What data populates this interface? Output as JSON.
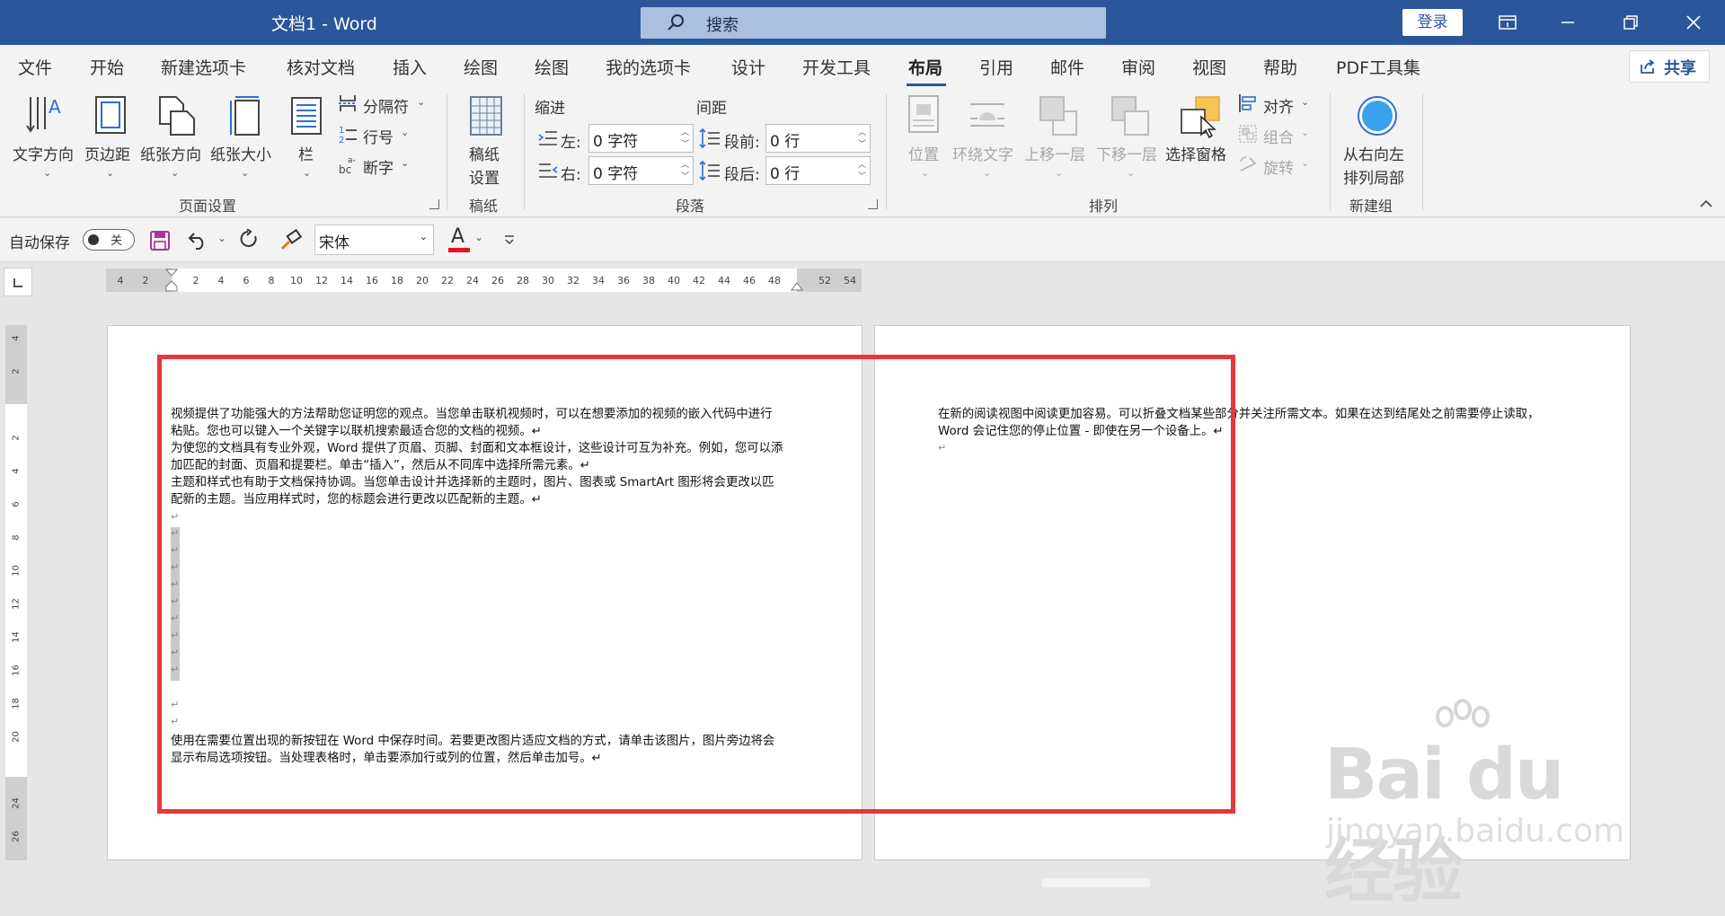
{
  "titlebar": {
    "doc_title": "文档1  -  Word",
    "search_label": "搜索",
    "login_label": "登录"
  },
  "menu": {
    "tabs": [
      "文件",
      "开始",
      "新建选项卡",
      "核对文档",
      "插入",
      "绘图",
      "绘图",
      "我的选项卡",
      "设计",
      "开发工具",
      "布局",
      "引用",
      "邮件",
      "审阅",
      "视图",
      "帮助",
      "PDF工具集"
    ],
    "active_tab": "布局",
    "share_label": "共享"
  },
  "ribbon": {
    "page_setup": {
      "text_direction": "文字方向",
      "margins": "页边距",
      "orientation": "纸张方向",
      "size": "纸张大小",
      "columns": "栏",
      "breaks": "分隔符",
      "line_numbers": "行号",
      "hyphenation": "断字",
      "group_label": "页面设置"
    },
    "manuscript": {
      "setup_line1": "稿纸",
      "setup_line2": "设置",
      "group_label": "稿纸"
    },
    "paragraph": {
      "indent_label": "缩进",
      "spacing_label": "间距",
      "left_label": "左:",
      "right_label": "右:",
      "before_label": "段前:",
      "after_label": "段后:",
      "left_value": "0 字符",
      "right_value": "0 字符",
      "before_value": "0 行",
      "after_value": "0 行",
      "group_label": "段落"
    },
    "arrange": {
      "position": "位置",
      "wrap_text": "环绕文字",
      "bring_forward": "上移一层",
      "send_backward": "下移一层",
      "selection_pane": "选择窗格",
      "align": "对齐",
      "group": "组合",
      "rotate": "旋转",
      "group_label": "排列"
    },
    "new_group": {
      "rtl_line1": "从右向左",
      "rtl_line2": "排列局部",
      "group_label": "新建组"
    }
  },
  "qat": {
    "autosave_label": "自动保存",
    "autosave_state": "关",
    "font_name": "宋体",
    "font_color_letter": "A"
  },
  "ruler": {
    "h_ticks": [
      "4",
      "2",
      "",
      "2",
      "4",
      "6",
      "8",
      "10",
      "12",
      "14",
      "16",
      "18",
      "20",
      "22",
      "24",
      "26",
      "28",
      "30",
      "32",
      "34",
      "36",
      "38",
      "40",
      "42",
      "44",
      "46",
      "48",
      "",
      "52",
      "54"
    ],
    "v_ticks": [
      "4",
      "2",
      "",
      "2",
      "4",
      "6",
      "8",
      "10",
      "12",
      "14",
      "16",
      "18",
      "20",
      "",
      "24",
      "26"
    ]
  },
  "page1": {
    "para1_line1": "视频提供了功能强大的方法帮助您证明您的观点。当您单击联机视频时，可以在想要添加的视频的嵌入代码中进行",
    "para1_line2": "粘贴。您也可以键入一个关键字以联机搜索最适合您的文档的视频。↵",
    "para2_line1": "为使您的文档具有专业外观，Word 提供了页眉、页脚、封面和文本框设计，这些设计可互为补充。例如，您可以添",
    "para2_line2": "加匹配的封面、页眉和提要栏。单击“插入”，然后从不同库中选择所需元素。↵",
    "para3_line1": "主题和样式也有助于文档保持协调。当您单击设计并选择新的主题时，图片、图表或 SmartArt 图形将会更改以匹",
    "para3_line2": "配新的主题。当应用样式时，您的标题会进行更改以匹配新的主题。↵",
    "para_mark": "↵",
    "para4_line1": "使用在需要位置出现的新按钮在 Word 中保存时间。若要更改图片适应文档的方式，请单击该图片，图片旁边将会",
    "para4_line2": "显示布局选项按钮。当处理表格时，单击要添加行或列的位置，然后单击加号。↵"
  },
  "page2": {
    "line1": "在新的阅读视图中阅读更加容易。可以折叠文档某些部分并关注所需文本。如果在达到结尾处之前需要停止读取，",
    "line2": "Word 会记住您的停止位置 - 即使在另一个设备上。↵",
    "mark": "↵"
  },
  "watermark": {
    "logo_text": "Bai du 经验",
    "url": "jingyan.baidu.com"
  },
  "colors": {
    "title_bar": "#2b579a",
    "highlight_box": "#e8373a",
    "font_color_bar": "#e81123"
  }
}
